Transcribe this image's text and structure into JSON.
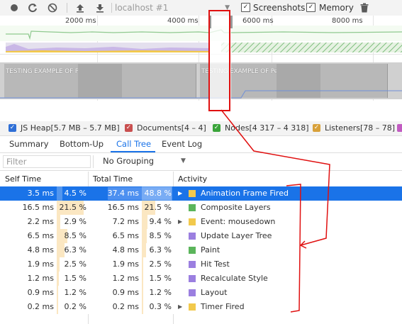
{
  "toolbar": {
    "profile_select": "localhost #1",
    "screenshots_label": "Screenshots",
    "memory_label": "Memory"
  },
  "overview": {
    "ruler": [
      "2000 ms",
      "4000 ms",
      "6000 ms",
      "8000 ms"
    ],
    "filmstrip_text": "TESTING EXAMPLE OF Performance TAB dev tools"
  },
  "legend": [
    {
      "label": "JS Heap[5.7 MB – 5.7 MB]",
      "color": "#2f6fd6"
    },
    {
      "label": "Documents[4 – 4]",
      "color": "#c94f4f"
    },
    {
      "label": "Nodes[4 317 – 4 318]",
      "color": "#3aa43a"
    },
    {
      "label": "Listeners[78 – 78]",
      "color": "#d8a13a"
    }
  ],
  "tabs": [
    "Summary",
    "Bottom-Up",
    "Call Tree",
    "Event Log"
  ],
  "active_tab": "Call Tree",
  "filter": {
    "placeholder": "Filter",
    "grouping": "No Grouping"
  },
  "columns": {
    "self": "Self Time",
    "total": "Total Time",
    "activity": "Activity"
  },
  "rows": [
    {
      "self": "3.5 ms",
      "self_pct": "4.5 %",
      "self_frac": 0.045,
      "total": "37.4 ms",
      "total_pct": "48.8 %",
      "total_frac": 0.488,
      "activity": "Animation Frame Fired",
      "color": "#f2c94c",
      "expandable": true
    },
    {
      "self": "16.5 ms",
      "self_pct": "21.5 %",
      "self_frac": 0.215,
      "total": "16.5 ms",
      "total_pct": "21.5 %",
      "total_frac": 0.215,
      "activity": "Composite Layers",
      "color": "#5bb55b",
      "expandable": false
    },
    {
      "self": "2.2 ms",
      "self_pct": "2.9 %",
      "self_frac": 0.029,
      "total": "7.2 ms",
      "total_pct": "9.4 %",
      "total_frac": 0.094,
      "activity": "Event: mousedown",
      "color": "#f2c94c",
      "expandable": true
    },
    {
      "self": "6.5 ms",
      "self_pct": "8.5 %",
      "self_frac": 0.085,
      "total": "6.5 ms",
      "total_pct": "8.5 %",
      "total_frac": 0.085,
      "activity": "Update Layer Tree",
      "color": "#9b7fe0",
      "expandable": false
    },
    {
      "self": "4.8 ms",
      "self_pct": "6.3 %",
      "self_frac": 0.063,
      "total": "4.8 ms",
      "total_pct": "6.3 %",
      "total_frac": 0.063,
      "activity": "Paint",
      "color": "#5bb55b",
      "expandable": false
    },
    {
      "self": "1.9 ms",
      "self_pct": "2.5 %",
      "self_frac": 0.025,
      "total": "1.9 ms",
      "total_pct": "2.5 %",
      "total_frac": 0.025,
      "activity": "Hit Test",
      "color": "#9b7fe0",
      "expandable": false
    },
    {
      "self": "1.2 ms",
      "self_pct": "1.5 %",
      "self_frac": 0.015,
      "total": "1.2 ms",
      "total_pct": "1.5 %",
      "total_frac": 0.015,
      "activity": "Recalculate Style",
      "color": "#9b7fe0",
      "expandable": false
    },
    {
      "self": "0.9 ms",
      "self_pct": "1.2 %",
      "self_frac": 0.012,
      "total": "0.9 ms",
      "total_pct": "1.2 %",
      "total_frac": 0.012,
      "activity": "Layout",
      "color": "#9b7fe0",
      "expandable": false
    },
    {
      "self": "0.2 ms",
      "self_pct": "0.2 %",
      "self_frac": 0.002,
      "total": "0.2 ms",
      "total_pct": "0.3 %",
      "total_frac": 0.003,
      "activity": "Timer Fired",
      "color": "#f2c94c",
      "expandable": true
    }
  ],
  "selected_row": 0
}
